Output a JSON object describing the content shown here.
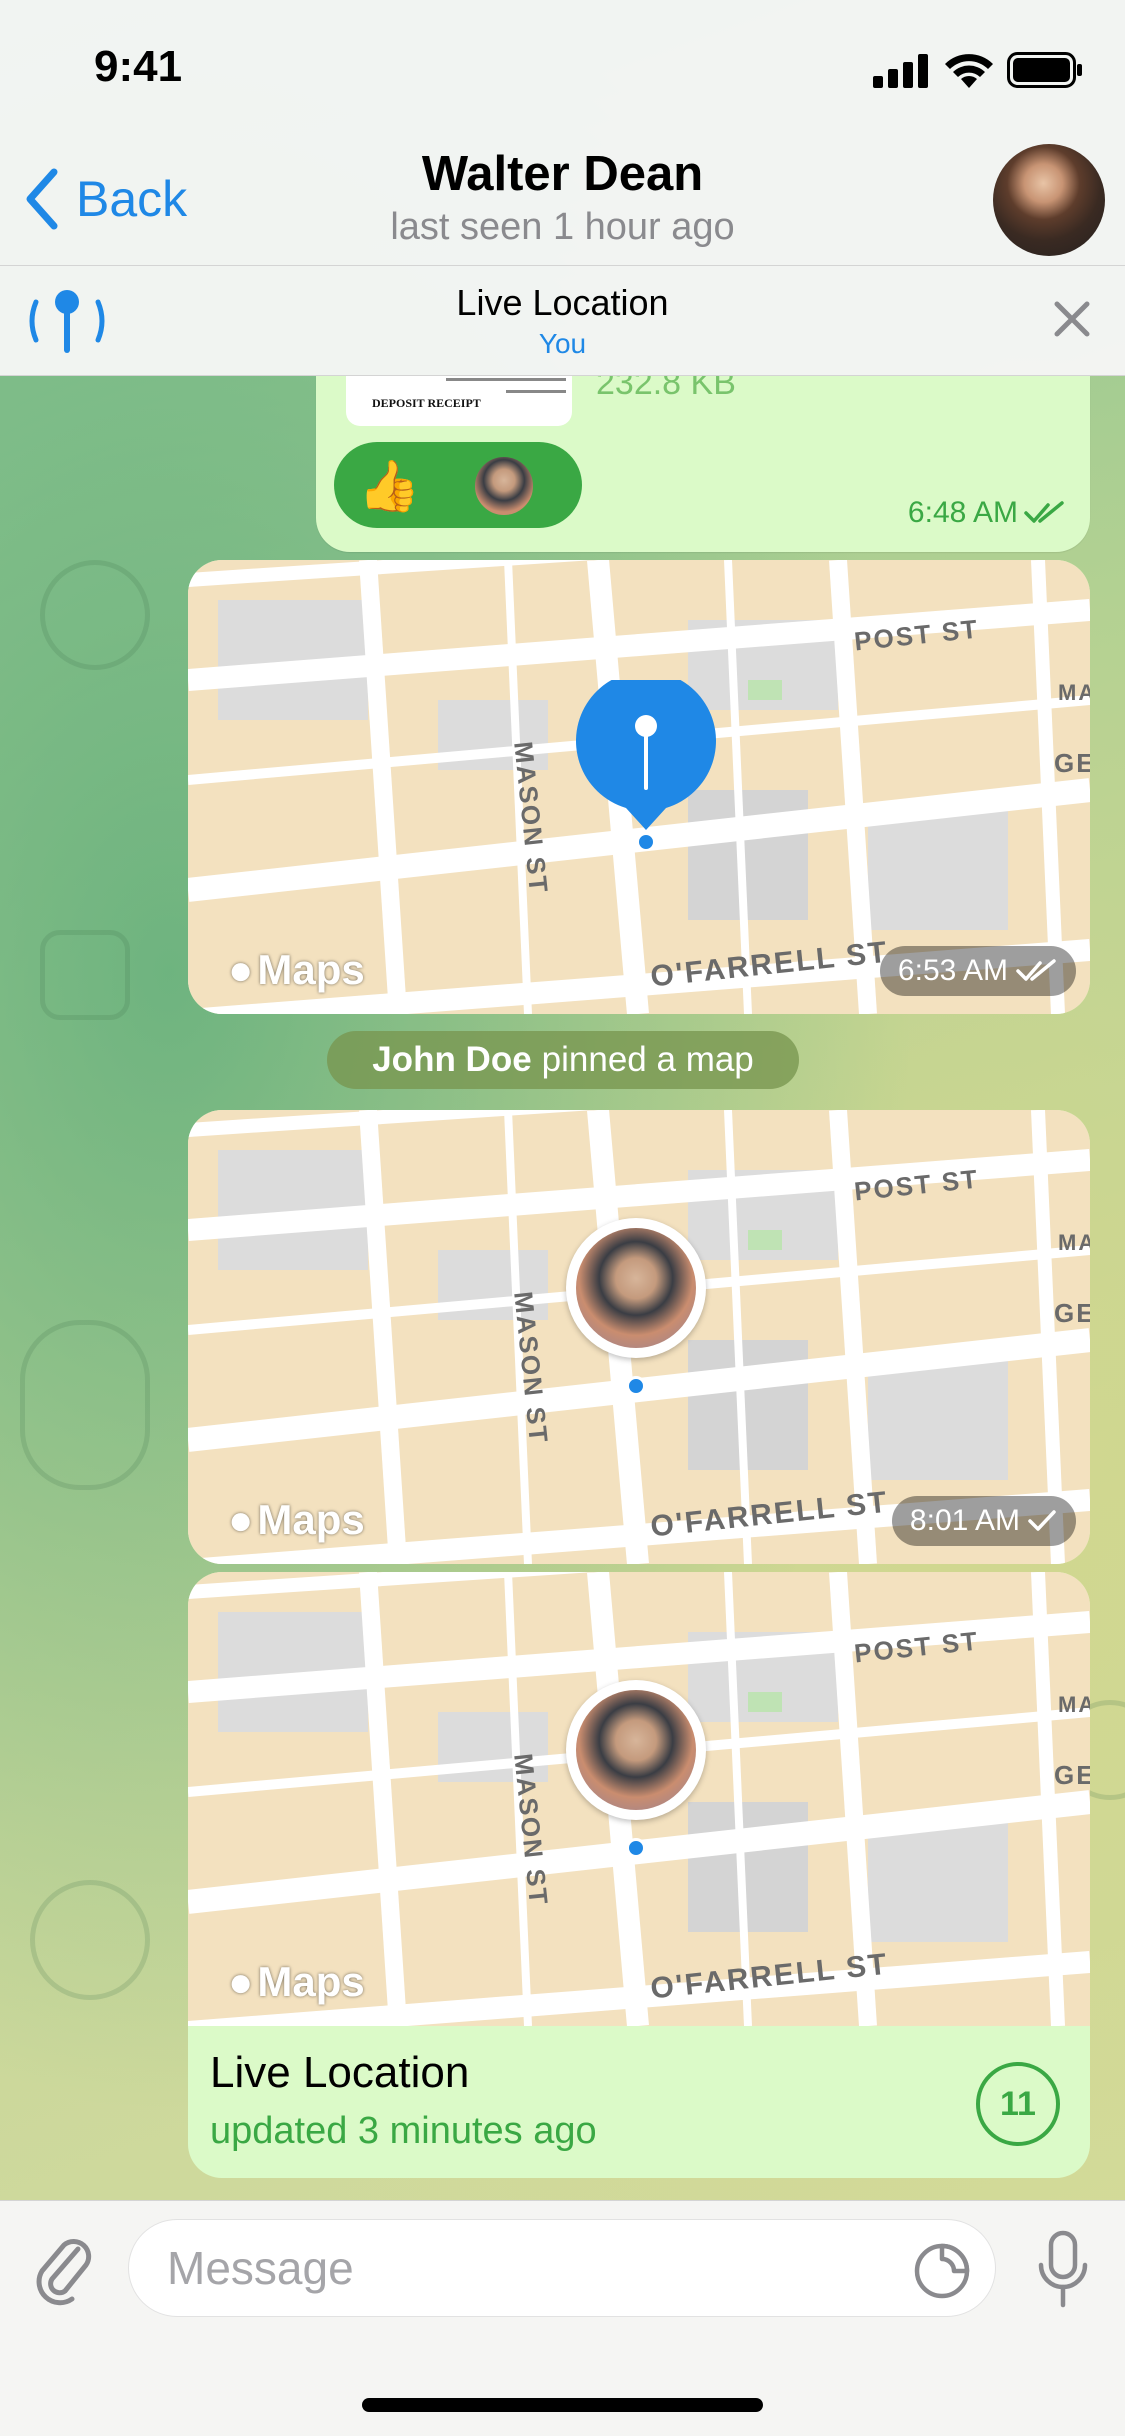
{
  "status_bar": {
    "time": "9:41"
  },
  "header": {
    "back_label": "Back",
    "contact_name": "Walter Dean",
    "contact_status": "last seen 1 hour ago"
  },
  "live_banner": {
    "title": "Live Location",
    "subtitle": "You"
  },
  "messages": {
    "doc": {
      "size": "232.8 KB",
      "doc_text": "DEPOSIT RECEIPT",
      "reaction_emoji": "👍",
      "time": "6:48 AM"
    },
    "location_1": {
      "time": "6:53 AM",
      "maps_label": "Maps"
    },
    "service": {
      "actor": "John Doe",
      "action": "pinned a map"
    },
    "location_2": {
      "time": "8:01 AM",
      "maps_label": "Maps"
    },
    "live_location": {
      "maps_label": "Maps",
      "title": "Live Location",
      "updated": "updated 3 minutes ago",
      "timer": "11"
    }
  },
  "map_labels": {
    "street_1": "POST ST",
    "street_2": "MASON ST",
    "street_3": "O'FARRELL ST",
    "street_4": "MA",
    "street_5": "GE"
  },
  "composer": {
    "placeholder": "Message"
  },
  "colors": {
    "accent": "#1f88e6",
    "outgoing_bubble": "#dbfac8",
    "green": "#3aa844"
  }
}
